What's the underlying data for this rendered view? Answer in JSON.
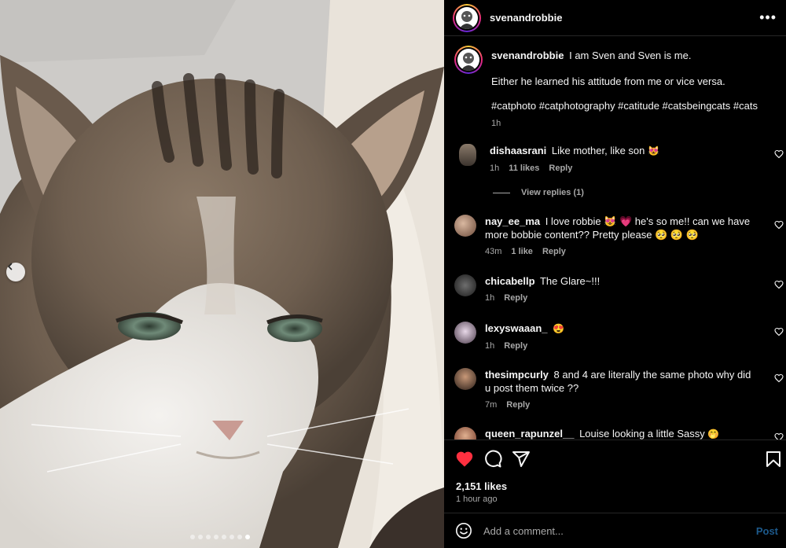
{
  "header": {
    "username": "svenandrobbie",
    "more_icon": "more-horizontal-icon"
  },
  "caption": {
    "username": "svenandrobbie",
    "line1": "I am Sven and Sven is me.",
    "line2": "Either he learned his attitude from me or vice versa.",
    "hashtags": "#catphoto #catphotography #catitude #catsbeingcats #cats",
    "time": "1h"
  },
  "comments": [
    {
      "username": "dishaasrani",
      "text": "Like mother, like son",
      "emoji": "😻",
      "time": "1h",
      "likes": "11 likes",
      "reply": "Reply"
    },
    {
      "username": "nay_ee_ma",
      "text": "I love robbie 😻 💗 he's so me!! can we have more bobbie content?? Pretty please 🥺 🥺 🥺",
      "emoji": "",
      "time": "43m",
      "likes": "1 like",
      "reply": "Reply"
    },
    {
      "username": "chicabellp",
      "text": "The Glare~!!!",
      "emoji": "",
      "time": "1h",
      "likes": "",
      "reply": "Reply"
    },
    {
      "username": "lexyswaaan_",
      "text": "",
      "emoji": "😍",
      "time": "1h",
      "likes": "",
      "reply": "Reply"
    },
    {
      "username": "thesimpcurly",
      "text": "8 and 4 are literally the same photo why did u post them twice ??",
      "emoji": "",
      "time": "7m",
      "likes": "",
      "reply": "Reply"
    },
    {
      "username": "queen_rapunzel__",
      "text": "Louise looking a little Sassy",
      "emoji": "🤭",
      "time": "",
      "likes": "",
      "reply": ""
    }
  ],
  "view_replies": "View replies (1)",
  "actions": {
    "likes": "2,151 likes",
    "posted": "1 hour ago",
    "liked_color": "#ff3040"
  },
  "add_comment": {
    "placeholder": "Add a comment...",
    "post_label": "Post"
  },
  "carousel": {
    "total": 8,
    "active_index": 7
  }
}
